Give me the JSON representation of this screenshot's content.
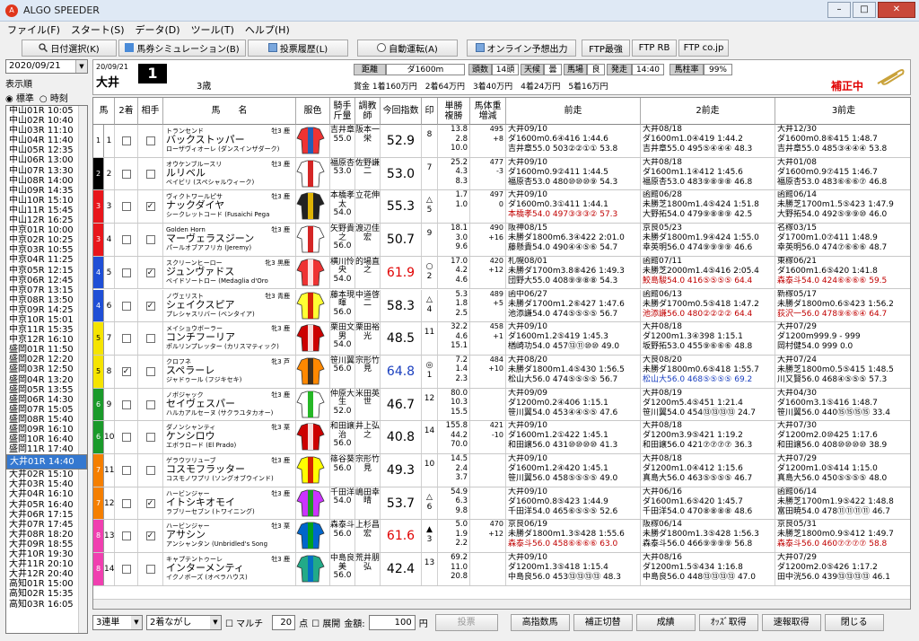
{
  "window": {
    "title": "ALGO SPEEDER",
    "minimize": "–",
    "maximize": "□",
    "close": "✕"
  },
  "menu": [
    "ファイル(F)",
    "スタート(S)",
    "データ(D)",
    "ツール(T)",
    "ヘルプ(H)"
  ],
  "toolbar": [
    {
      "label": "日付選択(K)",
      "icon": "search-icon"
    },
    {
      "label": "馬券シミュレーション(B)",
      "icon": "ticket-icon"
    },
    {
      "label": "投票履歴(L)",
      "icon": "document-icon"
    },
    {
      "label": "自動運転(A)",
      "icon": "clock-icon"
    },
    {
      "label": "オンライン予想出力",
      "icon": "document-icon"
    },
    {
      "label": "FTP最強",
      "icon": ""
    },
    {
      "label": "FTP RB",
      "icon": ""
    },
    {
      "label": "FTP co.jp",
      "icon": ""
    }
  ],
  "left": {
    "date": "2020/09/21",
    "display_label": "表示順",
    "radio_standard": "標準",
    "radio_time": "時刻",
    "selected_radio": "標準",
    "races": [
      "中山01R 10:05",
      "中山02R 10:40",
      "中山03R 11:10",
      "中山04R 11:40",
      "中山05R 12:35",
      "中山06R 13:00",
      "中山07R 13:30",
      "中山08R 14:00",
      "中山09R 14:35",
      "中山10R 15:10",
      "中山11R 15:45",
      "中山12R 16:25",
      "中京01R 10:00",
      "中京02R 10:25",
      "中京03R 10:55",
      "中京04R 11:25",
      "中京05R 12:15",
      "中京06R 12:45",
      "中京07R 13:15",
      "中京08R 13:50",
      "中京09R 14:25",
      "中京10R 15:01",
      "中京11R 15:35",
      "中京12R 16:10",
      "盛岡01R 11:50",
      "盛岡02R 12:20",
      "盛岡03R 12:50",
      "盛岡04R 13:20",
      "盛岡05R 13:55",
      "盛岡06R 14:30",
      "盛岡07R 15:05",
      "盛岡08R 15:40",
      "盛岡09R 16:10",
      "盛岡10R 16:40",
      "盛岡11R 17:40",
      "大井01R 14:40",
      "大井02R 15:10",
      "大井03R 15:40",
      "大井04R 16:10",
      "大井05R 16:40",
      "大井06R 17:15",
      "大井07R 17:45",
      "大井08R 18:20",
      "大井09R 18:55",
      "大井10R 19:30",
      "大井11R 20:10",
      "大井12R 20:40",
      "高知01R 15:00",
      "高知02R 15:35",
      "高知03R 16:05"
    ],
    "selected_index": 35
  },
  "header": {
    "date": "20/09/21",
    "track": "大井",
    "race_no": "1",
    "age": "3歳",
    "chips": [
      {
        "k": "距離",
        "v": "ダ1600m"
      },
      {
        "k": "頭数",
        "v": "14頭"
      },
      {
        "k": "天候",
        "v": "曇"
      },
      {
        "k": "馬場",
        "v": "良"
      },
      {
        "k": "発走",
        "v": "14:40"
      },
      {
        "k": "馬柱率",
        "v": "99%"
      }
    ],
    "prizes": [
      "賞金 1着160万円",
      "2着64万円",
      "3着40万円",
      "4着24万円",
      "5着16万円"
    ],
    "correcting": "補正中"
  },
  "columns": {
    "uma": "馬",
    "nichaku": "2着",
    "aite": "相手",
    "name": "馬　　名",
    "fukushoku": "服色",
    "jockey": "騎手\n斤量",
    "trainer": "調教\n師",
    "index": "今回指数",
    "mark": "印",
    "odds": "単勝\n複勝",
    "weight": "馬体重\n増減",
    "p1": "前走",
    "p2": "2前走",
    "p3": "3前走"
  },
  "horses": [
    {
      "waku": 1,
      "no": 1,
      "c2": false,
      "ca": false,
      "sire": "トランセンド",
      "sex": "牡3 鹿",
      "name": "バックストッパー",
      "dam": "ローザヴィオーレ (ダンスインザダーク)",
      "jockey": "吉井章",
      "kin": "55.0",
      "trainer": "阪本一栄",
      "idx": "52.9",
      "ic": "",
      "mark": "",
      "pop": "8",
      "odds": [
        "13.8",
        "2.8",
        "10.0"
      ],
      "wt": [
        "495",
        "+8",
        ""
      ],
      "p1": [
        "大井09/10",
        "05 14頭 07",
        "ダ1600m0.6④416 1:44.6",
        "吉井章55.0 503②②①① 53.8"
      ],
      "p2": [
        "大井08/18",
        "12 14頭 09",
        "ダ1600m1.0④419 1:44.2",
        "吉井章55.0 495⑤④④④ 48.3"
      ],
      "p3": [
        "大井12/30",
        "07 12頭 07",
        "ダ1600m0.8⑥415 1:48.7",
        "吉井章55.0 485③④④④ 53.8"
      ],
      "s": [
        "",
        "",
        ""
      ]
    },
    {
      "waku": 2,
      "no": 2,
      "c2": false,
      "ca": false,
      "sire": "オウケンブルースリ",
      "sex": "牡3 鹿",
      "name": "ルリベル",
      "dam": "ベイビリ (スペシャルウィーク)",
      "jockey": "福原杏",
      "kin": "53.0",
      "trainer": "佐野謙二",
      "idx": "53.0",
      "ic": "",
      "mark": "",
      "pop": "7",
      "odds": [
        "25.2",
        "4.3",
        "8.3"
      ],
      "wt": [
        "477",
        "-3",
        ""
      ],
      "p1": [
        "大井09/10",
        "04 14頭 06",
        "ダ1600m0.9②411 1:44.5",
        "福原杏53.0 480⑩⑩⑩⑨ 54.3"
      ],
      "p2": [
        "大井08/18",
        "04 14頭 06",
        "ダ1600m1.1④412 1:45.6",
        "福原杏53.0 483⑨⑧⑨⑧ 46.8"
      ],
      "p3": [
        "大井01/08",
        "ボリカンナ05 14頭 06",
        "ダ1600m0.9⑦415 1:46.7",
        "福原杏53.0 483⑥⑥⑥⑦ 46.8"
      ],
      "s": [
        "",
        "",
        ""
      ]
    },
    {
      "waku": 3,
      "no": 3,
      "c2": false,
      "ca": true,
      "sire": "ヴィクトワールピサ",
      "sex": "牡3 鹿",
      "name": "ナックダイヤ",
      "dam": "シークレットコード (Fusaichi Pega",
      "jockey": "本橋孝太",
      "kin": "54.0",
      "trainer": "立花伸",
      "idx": "55.3",
      "ic": "",
      "mark": "△",
      "pop": "5",
      "odds": [
        "1.7",
        "1.0",
        ""
      ],
      "wt": [
        "497",
        "0",
        ""
      ],
      "p1": [
        "大井09/10",
        "14 14頭 04",
        "ダ1600m0.3①411 1:44.1",
        "本橋孝54.0 497③③③② 57.3"
      ],
      "p2": [
        "函館06/28",
        "09 14頭 12",
        "未勝芝1800m1.4⑤424 1:51.8",
        "大野拓54.0 479⑨⑧⑧⑨ 42.5"
      ],
      "p3": [
        "函館06/14",
        "14 16頭 07",
        "未勝芝1700m1.5⑤423 1:47.9",
        "大野拓54.0 492⑤⑨⑨⑩ 46.0"
      ],
      "s": [
        "red",
        "",
        ""
      ]
    },
    {
      "waku": 3,
      "no": 4,
      "c2": false,
      "ca": false,
      "sire": "Golden Horn",
      "sex": "牡3 鹿",
      "name": "マーヴェラスジーン",
      "dam": "パールオブアフリカ (Jeremy)",
      "jockey": "矢野貴之",
      "kin": "56.0",
      "trainer": "渡辺佳宏",
      "idx": "50.7",
      "ic": "",
      "mark": "",
      "pop": "9",
      "odds": [
        "18.1",
        "3.0",
        "9.6"
      ],
      "wt": [
        "490",
        "+16",
        ""
      ],
      "p1": [
        "阪神08/15",
        "13 15頭 15",
        "未勝ダ1800m6.3④422 2:01.0",
        "藤懸貴54.0 490④④⑤⑥ 54.7"
      ],
      "p2": [
        "京良05/23",
        "15 18頭 16",
        "未勝ダ1800m1.9④424 1:55.0",
        "幸英明56.0 474⑨⑨⑨⑨ 46.6"
      ],
      "p3": [
        "名稼03/15",
        "01 16頭 03",
        "ダ1700m1.0⑦411 1:48.9",
        "幸英明56.0 474⑦⑥⑥⑥ 48.7"
      ],
      "s": [
        "",
        "",
        ""
      ]
    },
    {
      "waku": 4,
      "no": 5,
      "c2": false,
      "ca": true,
      "sire": "スクリーンヒーロー",
      "sex": "牝3 黒鹿",
      "name": "ジュンヴァドス",
      "dam": "ベイドソートロー (Medaglia d'Oro",
      "jockey": "横川怜央",
      "kin": "54.0",
      "trainer": "的場直之",
      "idx": "61.9",
      "ic": "red",
      "mark": "○",
      "pop": "2",
      "odds": [
        "17.0",
        "4.2",
        "4.6"
      ],
      "wt": [
        "420",
        "+12",
        ""
      ],
      "p1": [
        "札幌08/01",
        "03 14頭 11",
        "未勝ダ1700m3.8⑧426 1:49.3",
        "団野大55.0 408⑨⑨⑧⑧ 54.3"
      ],
      "p2": [
        "函館07/11",
        "05 16頭 11",
        "未勝芝2000m1.4⑤416 2:05.4",
        "鮫島駿54.0 416⑤⑤⑤⑤ 64.4"
      ],
      "p3": [
        "東稼06/21",
        "14 16頭 07",
        "ダ1600m1.6⑤420 1:41.8",
        "森泰斗54.0 424⑥⑥⑥⑥ 59.5"
      ],
      "s": [
        "",
        "red",
        "red"
      ]
    },
    {
      "waku": 4,
      "no": 6,
      "c2": false,
      "ca": true,
      "sire": "ノヴェリスト",
      "sex": "牡3 青鹿",
      "name": "シェイクスピア",
      "dam": "プレシャスリバー (ベンタイア)",
      "jockey": "藤本現暉",
      "kin": "56.0",
      "trainer": "中道啓二",
      "idx": "58.3",
      "ic": "",
      "mark": "△",
      "pop": "4",
      "odds": [
        "5.3",
        "1.8",
        "2.5"
      ],
      "wt": [
        "489",
        "+5",
        ""
      ],
      "p1": [
        "函中06/27",
        "02 14頭 09",
        "未勝ダ1700m1.2⑥427 1:47.6",
        "池添謙54.0 474⑤⑤⑤⑤ 56.7"
      ],
      "p2": [
        "函館06/13",
        "01 16頭 04",
        "未勝ダ1700m0.5⑤418 1:47.2",
        "池添謙56.0 480②②②② 64.4"
      ],
      "p3": [
        "新稼05/17",
        "11 15頭 03",
        "未勝ダ1800m0.6⑤423 1:56.2",
        "荻沢一56.0 478⑨⑥⑥④ 64.7"
      ],
      "s": [
        "",
        "red",
        "red"
      ]
    },
    {
      "waku": 5,
      "no": 7,
      "c2": false,
      "ca": false,
      "sire": "メイショウボーラー",
      "sex": "牝3 鹿",
      "name": "コンチフーリア",
      "dam": "ポルリンプレッター (カリスマティック)",
      "jockey": "栗田文男",
      "kin": "54.0",
      "trainer": "栗田裕光",
      "idx": "48.5",
      "ic": "",
      "mark": "",
      "pop": "11",
      "odds": [
        "32.2",
        "4.6",
        "15.1"
      ],
      "wt": [
        "458",
        "+1",
        ""
      ],
      "p1": [
        "大井09/10",
        "07 14頭 09",
        "ダ1600m1.2⑤419 1:45.3",
        "楢崎功54.0 457⑬⑪⑩⑩ 49.0"
      ],
      "p2": [
        "大井08/18",
        "11 13頭 05",
        "ダ1200m1.3④398 1:15.1",
        "坂野拓53.0 455⑨⑥⑥⑥ 48.8"
      ],
      "p3": [
        "大井07/29",
        "14 14頭 消",
        "ダ1200m999.9 - 999",
        "岡村健54.0 999 0.0"
      ],
      "s": [
        "",
        "",
        ""
      ]
    },
    {
      "waku": 5,
      "no": 8,
      "c2": true,
      "ca": false,
      "sire": "クロフネ",
      "sex": "牝3 芦",
      "name": "スペラーレ",
      "dam": "ジャドゥール (フジキセキ)",
      "jockey": "笹川翼",
      "kin": "56.0",
      "trainer": "宗形竹見",
      "idx": "64.8",
      "ic": "blue",
      "mark": "◎",
      "pop": "1",
      "odds": [
        "7.2",
        "1.4",
        "2.3"
      ],
      "wt": [
        "484",
        "+10",
        ""
      ],
      "p1": [
        "大井08/20",
        "01 12頭 05",
        "未勝ダ1800m1.4⑤430 1:56.5",
        "松山大56.0 474⑤⑤⑤⑤ 56.7"
      ],
      "p2": [
        "大良08/20",
        "01 12頭 02",
        "未勝ダ1800m0.6⑤418 1:55.7",
        "松山大56.0 468⑤⑤⑤⑤ 69.2"
      ],
      "p3": [
        "大井07/24",
        "14 16頭 05",
        "未勝芝1800m0.5⑤415 1:48.5",
        "川又賢56.0 468④⑤⑤⑤ 57.3"
      ],
      "s": [
        "",
        "blue",
        ""
      ]
    },
    {
      "waku": 6,
      "no": 9,
      "c2": false,
      "ca": false,
      "sire": "ノボジャック",
      "sex": "牡3 鹿",
      "name": "セイヴェスパー",
      "dam": "ハルカアルセーヌ (サクラユタカオー)",
      "jockey": "仲原大生",
      "kin": "52.0",
      "trainer": "米田英世",
      "idx": "46.7",
      "ic": "",
      "mark": "",
      "pop": "12",
      "odds": [
        "80.0",
        "10.3",
        "15.5"
      ],
      "wt": [
        "",
        "",
        " "
      ],
      "p1": [
        "大井09/09",
        "12 12頭 02",
        "ダ1200m0.2④406 1:15.1",
        "笹川翼54.0 453④④⑤⑤ 47.6"
      ],
      "p2": [
        "大井08/19",
        "02 16頭 12",
        "ダ1200m5.4⑤451 1:21.4",
        "笹川翼54.0 454⑬⑬⑬⑬ 24.7"
      ],
      "p3": [
        "大井04/30",
        "11 16頭 12",
        "ダ1600m3.1⑤416 1:48.7",
        "笹川翼56.0 440⑮⑮⑮⑮ 33.4"
      ],
      "s": [
        "",
        "",
        ""
      ]
    },
    {
      "waku": 6,
      "no": 10,
      "c2": false,
      "ca": false,
      "sire": "ダノンシャンティ",
      "sex": "牝3 栗",
      "name": "ケンシロウ",
      "dam": "エボラロード (El Prado)",
      "jockey": "和田譲治",
      "kin": "56.0",
      "trainer": "井上弘之",
      "idx": "40.8",
      "ic": "",
      "mark": "",
      "pop": "14",
      "odds": [
        "155.8",
        "44.2",
        "70.0"
      ],
      "wt": [
        "421",
        "-10",
        ""
      ],
      "p1": [
        "大井09/10",
        "04 14頭 10",
        "ダ1600m1.2①422 1:45.1",
        "和田譲56.0 431⑩⑩⑩⑩ 41.3"
      ],
      "p2": [
        "大井08/18",
        "14 14頭 14",
        "ダ1200m3.9⑤421 1:19.2",
        "和田譲56.0 421⑦⑦⑦⑦ 36.3"
      ],
      "p3": [
        "大井07/30",
        "05 14頭 13",
        "ダ1200m2.0⑩425 1:17.6",
        "和田譲56.0 408⑩⑩⑩⑩ 38.9"
      ],
      "s": [
        "",
        "",
        ""
      ]
    },
    {
      "waku": 7,
      "no": 11,
      "c2": false,
      "ca": false,
      "sire": "ゲラウツリューブ",
      "sex": "牡3 鹿",
      "name": "コスモフラッター",
      "dam": "コスモノワプリ (ソングオブウインド)",
      "jockey": "篠谷葵",
      "kin": "56.0",
      "trainer": "宗形竹見",
      "idx": "49.3",
      "ic": "",
      "mark": "",
      "pop": "10",
      "odds": [
        "14.5",
        "2.4",
        "3.7"
      ],
      "wt": [
        "",
        "",
        " "
      ],
      "p1": [
        "大井09/10",
        "02 14頭 10",
        "ダ1600m1.2④420 1:45.1",
        "笹川翼56.0 458⑤⑤⑤⑤ 49.0"
      ],
      "p2": [
        "大井08/18",
        "10 12頭 08",
        "ダ1200m1.0④412 1:15.6",
        "真島大56.0 463⑤⑤⑤⑤ 46.7"
      ],
      "p3": [
        "大井07/29",
        "10 12頭 08",
        "ダ1200m1.0⑤414 1:15.0",
        "真島大56.0 450⑤⑤⑤⑤ 48.0"
      ],
      "s": [
        "",
        "",
        ""
      ]
    },
    {
      "waku": 7,
      "no": 12,
      "c2": false,
      "ca": true,
      "sire": "ハービンジャー",
      "sex": "牡3 鹿",
      "name": "イトシキオモイ",
      "dam": "ラブリーセブン (トワイニング)",
      "jockey": "千田洋",
      "kin": "54.0",
      "trainer": "嶋田幸晴",
      "idx": "53.7",
      "ic": "",
      "mark": "△",
      "pop": "6",
      "odds": [
        "54.9",
        "6.3",
        "9.8"
      ],
      "wt": [
        "",
        "",
        " "
      ],
      "p1": [
        "大井09/10",
        "04 14頭 08",
        "ダ1600m0.8⑤423 1:44.9",
        "千田洋54.0 465⑥⑤⑤⑤ 52.6"
      ],
      "p2": [
        "大井06/16",
        "06 16頭 06",
        "ダ1600m1.6⑤420 1:45.7",
        "千田洋54.0 470⑧⑧⑧⑧ 48.6"
      ],
      "p3": [
        "函館06/14",
        "05 16頭 15",
        "未勝芝1700m1.9⑤422 1:48.8",
        "富田暁54.0 478⑪⑪⑪⑪ 46.7"
      ],
      "s": [
        "",
        "",
        ""
      ]
    },
    {
      "waku": 8,
      "no": 13,
      "c2": false,
      "ca": true,
      "sire": "ハービンジャー",
      "sex": "牡3 栗",
      "name": "アサシン",
      "dam": "アンシャンタン (Unbridled's Song",
      "jockey": "森泰斗",
      "kin": "56.0",
      "trainer": "上杉昌宏",
      "idx": "61.6",
      "ic": "red",
      "mark": "▲",
      "pop": "3",
      "odds": [
        "5.0",
        "1.9",
        "2.2"
      ],
      "wt": [
        "470",
        "+12",
        ""
      ],
      "p1": [
        "京良06/19",
        "フォー12 15頭 04",
        "未勝ダ1800m1.3⑤428 1:55.6",
        "森泰斗56.0 458⑥⑥⑥⑥ 63.0"
      ],
      "p2": [
        "阪稼06/14",
        "05 16頭 04",
        "未勝ダ1800m1.3⑤428 1:56.3",
        "森泰斗56.0 466⑨⑨⑨⑨ 56.8"
      ],
      "p3": [
        "京良05/31",
        "07 16頭 04",
        "未勝芝1800m0.9⑤412 1:49.7",
        "森泰斗56.0 460⑦⑦⑦⑦ 58.8"
      ],
      "s": [
        "red",
        "",
        "red"
      ]
    },
    {
      "waku": 8,
      "no": 14,
      "c2": false,
      "ca": false,
      "sire": "キャプテントゥーレ",
      "sex": "牡3 鹿",
      "name": "インターメンティ",
      "dam": "イクノボーズ (オペラハウス)",
      "jockey": "中島良美",
      "kin": "56.0",
      "trainer": "荒井朋弘",
      "idx": "42.4",
      "ic": "",
      "mark": "",
      "pop": "13",
      "odds": [
        "69.2",
        "11.0",
        "20.8"
      ],
      "wt": [
        "",
        "",
        " "
      ],
      "p1": [
        "大井09/10",
        "10 12頭 07",
        "ダ1200m1.3⑤418 1:15.4",
        "中島良56.0 453⑬⑬⑬⑬ 48.3"
      ],
      "p2": [
        "大井08/16",
        "06 16頭 11",
        "ダ1200m1.5⑤434 1:16.8",
        "中島良56.0 448⑬⑬⑬⑬ 47.0"
      ],
      "p3": [
        "大井07/29",
        "11 16頭 14",
        "ダ1200m2.0⑤426 1:17.2",
        "田中洸56.0 439⑬⑬⑬⑬ 46.1"
      ],
      "s": [
        "",
        "",
        ""
      ]
    }
  ],
  "waku_colors": {
    "1": "#ffffff",
    "2": "#000000",
    "3": "#e8161b",
    "4": "#1f4fd6",
    "5": "#f5e400",
    "6": "#1a9a2a",
    "7": "#f57f00",
    "8": "#f03fb0"
  },
  "bottom": {
    "bet_type": "3連単",
    "method": "2着ながし",
    "multi_label": "マルチ",
    "points": "20",
    "points_unit": "点",
    "expand_label": "展開",
    "amount_label": "金額:",
    "amount": "100",
    "amount_unit": "円",
    "vote": "投票",
    "buttons": [
      "高指数馬",
      "補正切替",
      "成績",
      "ｵｯｽﾞ取得",
      "速報取得",
      "閉じる"
    ]
  }
}
